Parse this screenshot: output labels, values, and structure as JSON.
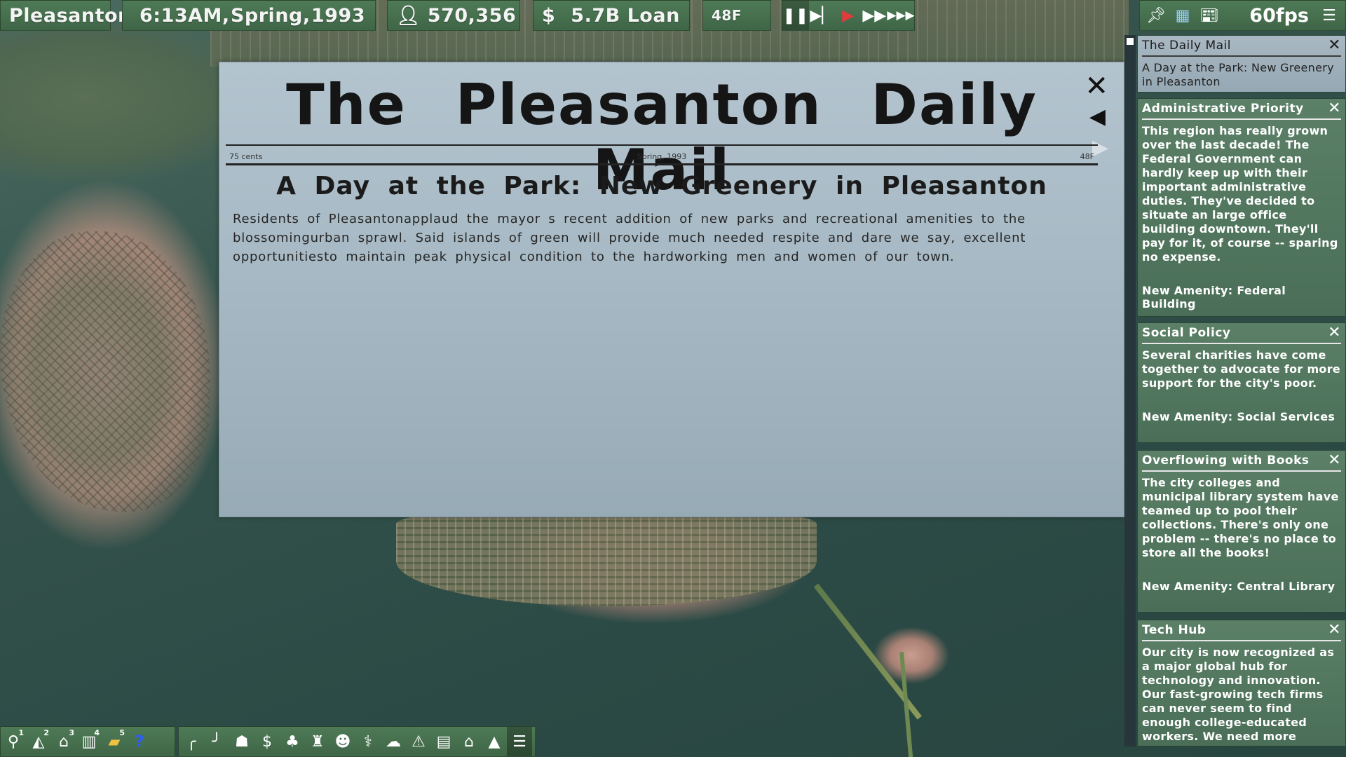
{
  "hud": {
    "city_name": "Pleasanton",
    "time": "6:13AM,",
    "season": "Spring,",
    "year": "1993",
    "population_icon": "person-icon",
    "population": "570,356",
    "money_icon": "dollar-icon",
    "money": "5.7B Loan",
    "temperature": "48F",
    "fps": "60fps"
  },
  "speed_controls": [
    {
      "name": "pause-button",
      "glyph": "❚❚"
    },
    {
      "name": "step-button",
      "glyph": "▶❙"
    },
    {
      "name": "play-button",
      "glyph": "▶"
    },
    {
      "name": "fast-forward-button",
      "glyph": "⏩"
    },
    {
      "name": "fastest-button",
      "glyph": "⏭"
    }
  ],
  "right_hud_icons": [
    "pin-icon",
    "grid-icon",
    "newspaper-icon",
    "menu-icon"
  ],
  "newspaper": {
    "title": "The Pleasanton Daily Mail",
    "price": "75 cents",
    "date": "Spring, 1993",
    "temperature": "48F",
    "headline": "A Day at the Park: New Greenery in Pleasanton",
    "body": "Residents of Pleasantonapplaud the mayor    s recent addition of new parks and recreational amenities to the blossomingurban sprawl. Said islands of green will provide much needed respite    and dare we say, excellent opportunitiesto maintain peak physical condition    to the hardworking men and women of our town."
  },
  "notifications": [
    {
      "title": "The Daily Mail",
      "body": "A Day at the Park: New Greenery in Pleasanton",
      "amenity": ""
    },
    {
      "title": "Administrative Priority",
      "body": "This region has really grown over the last decade! The Federal Government can hardly keep up with their important administrative duties. They've decided to situate an large office building downtown. They'll pay for it, of course -- sparing no expense.",
      "amenity": "New Amenity: Federal Building"
    },
    {
      "title": "Social Policy",
      "body": "Several charities have come together to advocate for more support for the city's poor.",
      "amenity": "New Amenity: Social Services"
    },
    {
      "title": "Overflowing with Books",
      "body": "The city colleges and municipal library system have teamed up to pool their collections. There's only one problem -- there's no place to store all the books!",
      "amenity": "New Amenity: Central Library"
    },
    {
      "title": "Tech Hub",
      "body": "Our city is now recognized as a major global hub for technology and innovation. Our fast-growing tech firms can never seem to find enough college-educated workers. We need more colleges!",
      "amenity": ""
    }
  ],
  "toolbar_left": [
    {
      "icon": "search-icon",
      "glyph": "⚲",
      "hotkey": "1"
    },
    {
      "icon": "road-icon",
      "glyph": "◭",
      "hotkey": "2"
    },
    {
      "icon": "house-icon",
      "glyph": "⌂",
      "hotkey": "3"
    },
    {
      "icon": "factory-icon",
      "glyph": "▥",
      "hotkey": "4"
    },
    {
      "icon": "commerce-icon",
      "glyph": "▰",
      "hotkey": "5"
    },
    {
      "icon": "help-icon",
      "glyph": "?",
      "hotkey": ""
    }
  ],
  "toolbar_right": [
    {
      "icon": "street-icon",
      "glyph": "╭"
    },
    {
      "icon": "express-road-icon",
      "glyph": "╯"
    },
    {
      "icon": "school-icon",
      "glyph": "☗"
    },
    {
      "icon": "money-icon",
      "glyph": "$"
    },
    {
      "icon": "park-icon",
      "glyph": "♣"
    },
    {
      "icon": "tower-icon",
      "glyph": "♜"
    },
    {
      "icon": "people-icon",
      "glyph": "☻"
    },
    {
      "icon": "hospital-icon",
      "glyph": "⚕"
    },
    {
      "icon": "police-icon",
      "glyph": "☁"
    },
    {
      "icon": "warning-icon",
      "glyph": "⚠"
    },
    {
      "icon": "transit-icon",
      "glyph": "▤"
    },
    {
      "icon": "home-icon",
      "glyph": "⌂"
    },
    {
      "icon": "farm-icon",
      "glyph": "▲"
    },
    {
      "icon": "news-icon",
      "glyph": "☰"
    }
  ]
}
